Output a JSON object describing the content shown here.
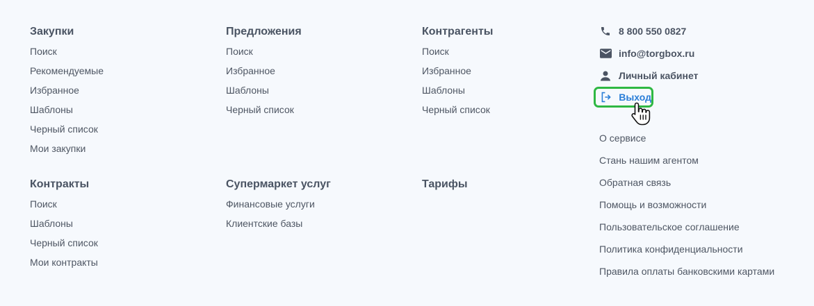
{
  "columns": [
    {
      "sections": [
        {
          "title": "Закупки",
          "links": [
            "Поиск",
            "Рекомендуемые",
            "Избранное",
            "Шаблоны",
            "Черный список",
            "Мои закупки"
          ]
        },
        {
          "title": "Контракты",
          "links": [
            "Поиск",
            "Шаблоны",
            "Черный список",
            "Мои контракты"
          ]
        }
      ]
    },
    {
      "sections": [
        {
          "title": "Предложения",
          "links": [
            "Поиск",
            "Избранное",
            "Шаблоны",
            "Черный список"
          ]
        },
        {
          "title": "Супермаркет услуг",
          "links": [
            "Финансовые услуги",
            "Клиентские базы"
          ]
        }
      ]
    },
    {
      "sections": [
        {
          "title": "Контрагенты",
          "links": [
            "Поиск",
            "Избранное",
            "Шаблоны",
            "Черный список"
          ]
        },
        {
          "title": "Тарифы",
          "links": []
        }
      ]
    }
  ],
  "contacts": {
    "phone": "8 800 550 0827",
    "email": "info@torgbox.ru",
    "account": "Личный кабинет",
    "logout": "Выход",
    "icons": {
      "phone": "phone-icon",
      "email": "envelope-icon",
      "account": "user-icon",
      "logout": "logout-icon"
    }
  },
  "info_links": [
    "О сервисе",
    "Стань нашим агентом",
    "Обратная связь",
    "Помощь и возможности",
    "Пользовательское соглашение",
    "Политика конфиденциальности",
    "Правила оплаты банковскими картами"
  ],
  "colors": {
    "background": "#f6f9fd",
    "text": "#4e5663",
    "logout_text": "#2a7ed8",
    "highlight_border": "#2fb843"
  }
}
